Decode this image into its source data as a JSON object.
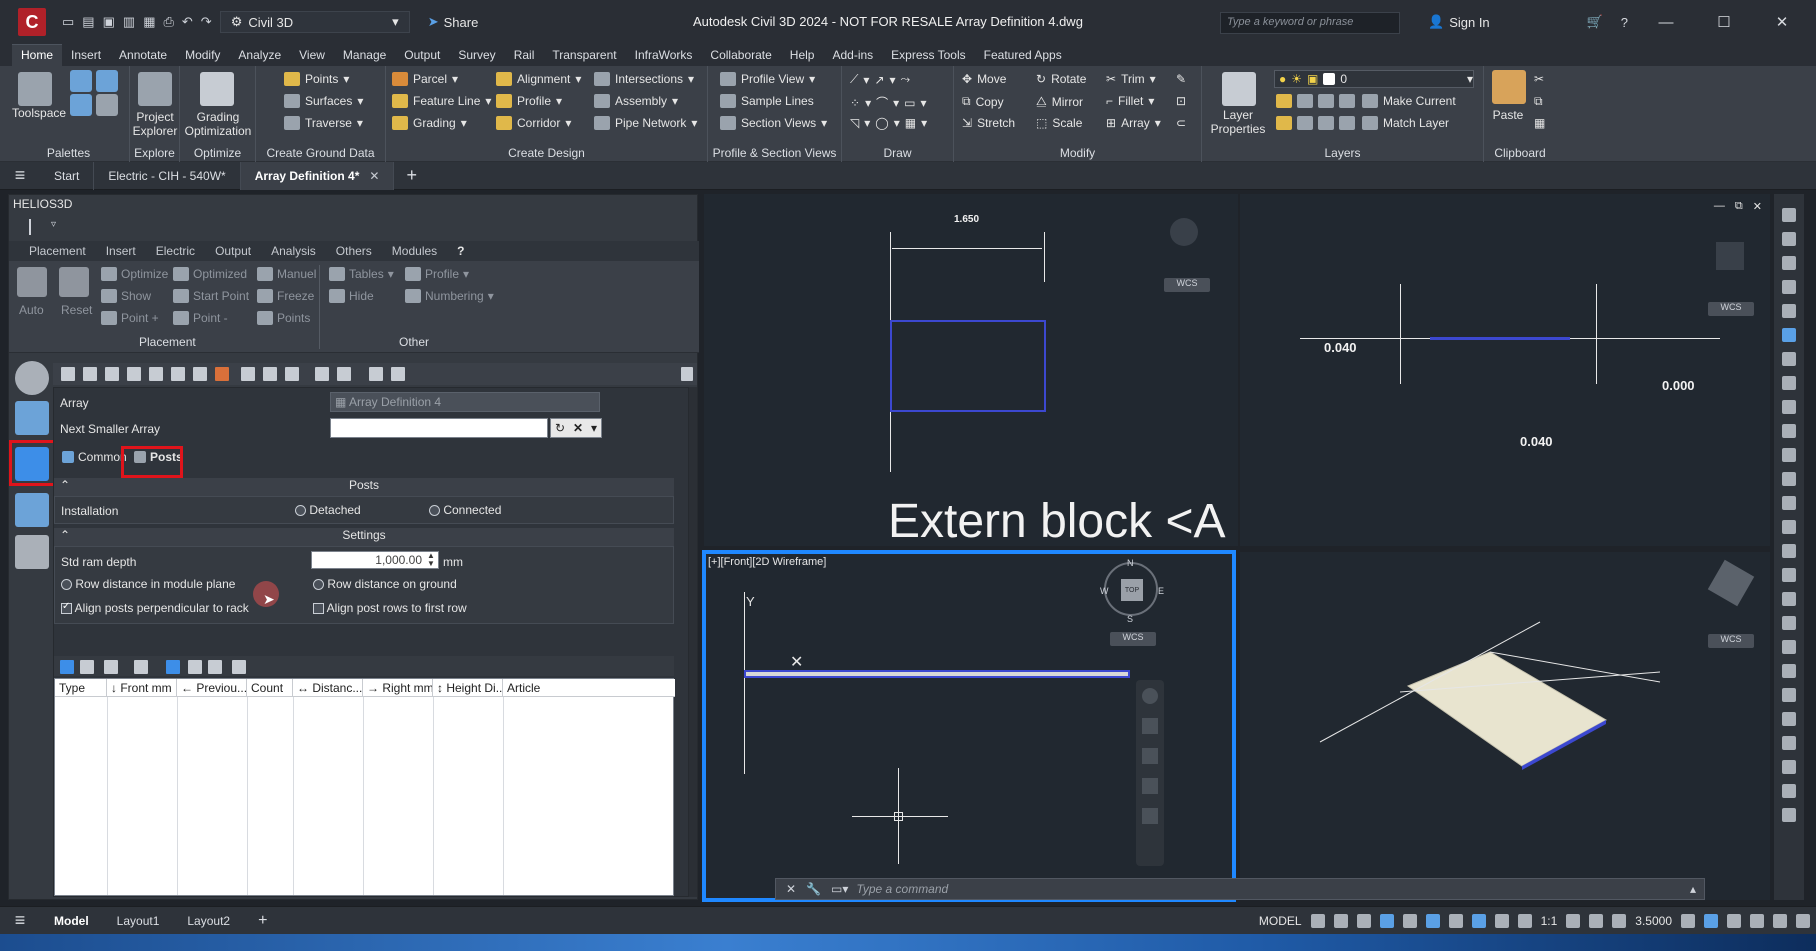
{
  "titlebar": {
    "app_letter": "C",
    "workspace": "Civil 3D",
    "share": "Share",
    "title": "Autodesk Civil 3D 2024 - NOT FOR RESALE   Array Definition 4.dwg",
    "search_placeholder": "Type a keyword or phrase",
    "signin": "Sign In"
  },
  "ribbon_tabs": [
    "Home",
    "Insert",
    "Annotate",
    "Modify",
    "Analyze",
    "View",
    "Manage",
    "Output",
    "Survey",
    "Rail",
    "Transparent",
    "InfraWorks",
    "Collaborate",
    "Help",
    "Add-ins",
    "Express Tools",
    "Featured Apps"
  ],
  "ribbon": {
    "toolspace": "Toolspace",
    "project_explorer": "Project Explorer",
    "grading_optimization": "Grading Optimization",
    "groups": {
      "palettes": "Palettes",
      "explore": "Explore",
      "optimize": "Optimize",
      "create_ground_data": "Create Ground Data",
      "create_design": "Create Design",
      "profile_section_views": "Profile & Section Views",
      "draw": "Draw",
      "modify": "Modify",
      "layers": "Layers",
      "clipboard": "Clipboard"
    },
    "ground": [
      "Points",
      "Surfaces",
      "Traverse"
    ],
    "design_col1": [
      "Parcel",
      "Feature Line",
      "Grading"
    ],
    "design_col2": [
      "Alignment",
      "Profile",
      "Corridor"
    ],
    "design_col3": [
      "Intersections",
      "Assembly",
      "Pipe Network"
    ],
    "profile_views": [
      "Profile View",
      "Sample Lines",
      "Section Views"
    ],
    "modify_col1": [
      "Move",
      "Copy",
      "Stretch"
    ],
    "modify_col2": [
      "Rotate",
      "Mirror",
      "Scale"
    ],
    "modify_col3": [
      "Trim",
      "Fillet",
      "Array"
    ],
    "layer_properties": "Layer Properties",
    "layer_value": "0",
    "make_current": "Make Current",
    "match_layer": "Match Layer",
    "paste": "Paste"
  },
  "doc_tabs": {
    "start": "Start",
    "tab1": "Electric - CIH - 540W*",
    "tab2": "Array Definition 4*"
  },
  "palette": {
    "title": "HELIOS3D",
    "tabs": [
      "Placement",
      "Insert",
      "Electric",
      "Output",
      "Analysis",
      "Others",
      "Modules"
    ],
    "help": "?",
    "placement": {
      "auto": "Auto",
      "reset": "Reset",
      "optimize": "Optimize",
      "show": "Show",
      "point_plus": "Point +",
      "optimized": "Optimized",
      "start_point": "Start Point",
      "point_minus": "Point -",
      "manuel": "Manuel",
      "freeze": "Freeze",
      "points": "Points",
      "group": "Placement"
    },
    "other": {
      "tables": "Tables",
      "hide": "Hide",
      "profile": "Profile",
      "numbering": "Numbering",
      "group": "Other"
    },
    "form": {
      "array_label": "Array",
      "array_value": "Array Definition 4",
      "next_smaller_label": "Next Smaller Array",
      "next_smaller_value": "",
      "tab_common": "Common",
      "tab_posts": "Posts",
      "posts_header": "Posts",
      "installation_label": "Installation",
      "detached": "Detached",
      "connected": "Connected",
      "settings_header": "Settings",
      "std_ram_label": "Std ram depth",
      "std_ram_value": "1,000.00",
      "std_ram_unit": "mm",
      "row_dist_module": "Row distance in module plane",
      "row_dist_ground": "Row distance on ground",
      "align_perp": "Align posts perpendicular to rack",
      "align_rows": "Align post rows to first row"
    },
    "table_columns": [
      "Type",
      "↓ Front mm",
      "← Previou...",
      "Count",
      "↔ Distanc...",
      "→ Right mm",
      "↕ Height Di...",
      "Article"
    ]
  },
  "viewports": {
    "top_left": {
      "dim": "1.650",
      "big_text": "Extern block <A"
    },
    "top_right": {
      "dim1": "0.040",
      "dim2": "0.000",
      "dim3": "0.040"
    },
    "bottom_left": {
      "label": "[+][Front][2D Wireframe]",
      "wcs": "WCS",
      "compass_n": "N",
      "compass_s": "S",
      "compass_e": "E",
      "compass_w": "W",
      "top": "TOP",
      "y_axis": "Y"
    },
    "wcs": "WCS"
  },
  "command": {
    "placeholder": "Type a command"
  },
  "statusbar": {
    "tabs": [
      "Model",
      "Layout1",
      "Layout2"
    ],
    "model_label": "MODEL",
    "scale": "1:1",
    "value": "3.5000"
  }
}
